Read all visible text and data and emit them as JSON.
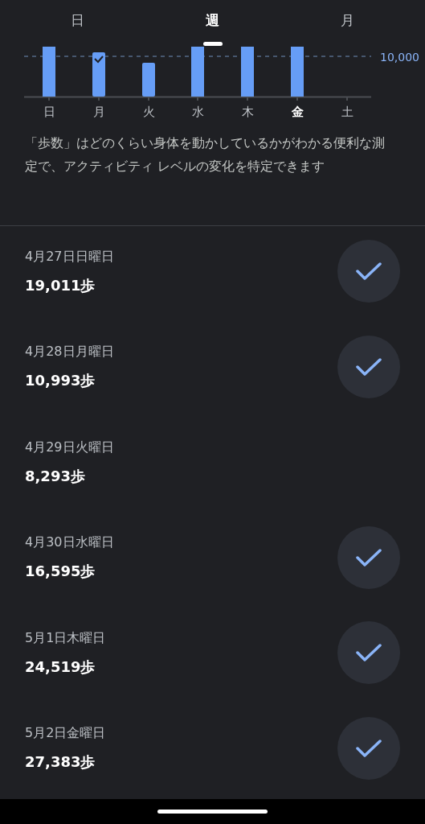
{
  "tabs": [
    {
      "label": "日",
      "selected": false
    },
    {
      "label": "週",
      "selected": true
    },
    {
      "label": "月",
      "selected": false
    }
  ],
  "chart": {
    "goal_label": "10,000",
    "days": [
      {
        "label": "日",
        "selected": false
      },
      {
        "label": "月",
        "selected": false
      },
      {
        "label": "火",
        "selected": false
      },
      {
        "label": "水",
        "selected": false
      },
      {
        "label": "木",
        "selected": false
      },
      {
        "label": "金",
        "selected": true
      },
      {
        "label": "土",
        "selected": false
      }
    ]
  },
  "description": "「歩数」はどのくらい身体を動かしているかがわかる便利な測定で、アクティビティ レベルの変化を特定できます",
  "entries": [
    {
      "date": "4月27日日曜日",
      "steps": "19,011歩",
      "goal_met": true
    },
    {
      "date": "4月28日月曜日",
      "steps": "10,993歩",
      "goal_met": true
    },
    {
      "date": "4月29日火曜日",
      "steps": "8,293歩",
      "goal_met": false
    },
    {
      "date": "4月30日水曜日",
      "steps": "16,595歩",
      "goal_met": true
    },
    {
      "date": "5月1日木曜日",
      "steps": "24,519歩",
      "goal_met": true
    },
    {
      "date": "5月2日金曜日",
      "steps": "27,383歩",
      "goal_met": true
    }
  ]
}
